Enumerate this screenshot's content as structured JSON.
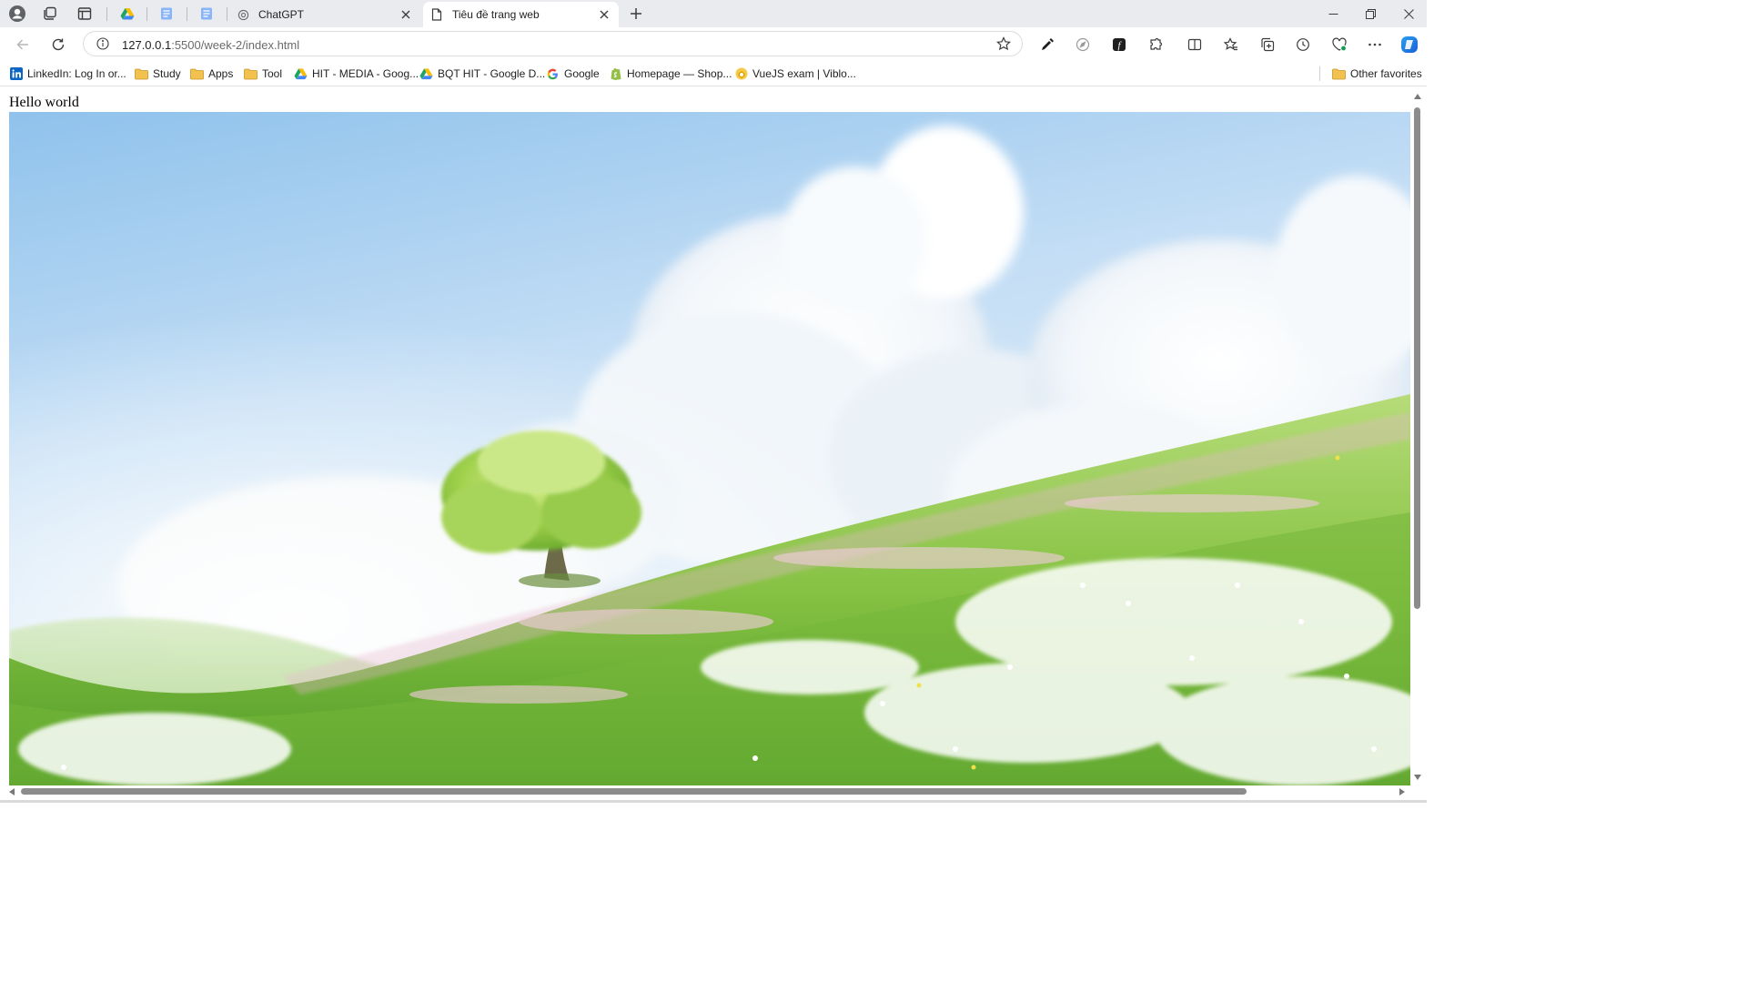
{
  "tabs": [
    {
      "title": "ChatGPT",
      "active": false
    },
    {
      "title": "Tiêu đề trang web",
      "active": true
    }
  ],
  "address": {
    "host": "127.0.0.1",
    "path": ":5500/week-2/index.html"
  },
  "favorites": [
    {
      "label": "LinkedIn: Log In or...",
      "icon": "linkedin-icon"
    },
    {
      "label": "Study",
      "icon": "folder-icon"
    },
    {
      "label": "Apps",
      "icon": "folder-icon"
    },
    {
      "label": "Tool",
      "icon": "folder-icon"
    },
    {
      "label": "HIT - MEDIA - Goog...",
      "icon": "google-drive-icon"
    },
    {
      "label": "BQT HIT - Google D...",
      "icon": "google-drive-icon"
    },
    {
      "label": "Google",
      "icon": "google-icon"
    },
    {
      "label": "Homepage — Shop...",
      "icon": "shopify-icon"
    },
    {
      "label": "VueJS exam | Viblo...",
      "icon": "viblo-icon"
    }
  ],
  "other_favorites": "Other favorites",
  "page": {
    "heading": "Hello world",
    "image": "landscape-image"
  },
  "colors": {
    "tabstrip": "#e9ebee",
    "accent": "#1a73e8",
    "sky_top": "#8fc2ec",
    "grass": "#7fbf3a"
  }
}
